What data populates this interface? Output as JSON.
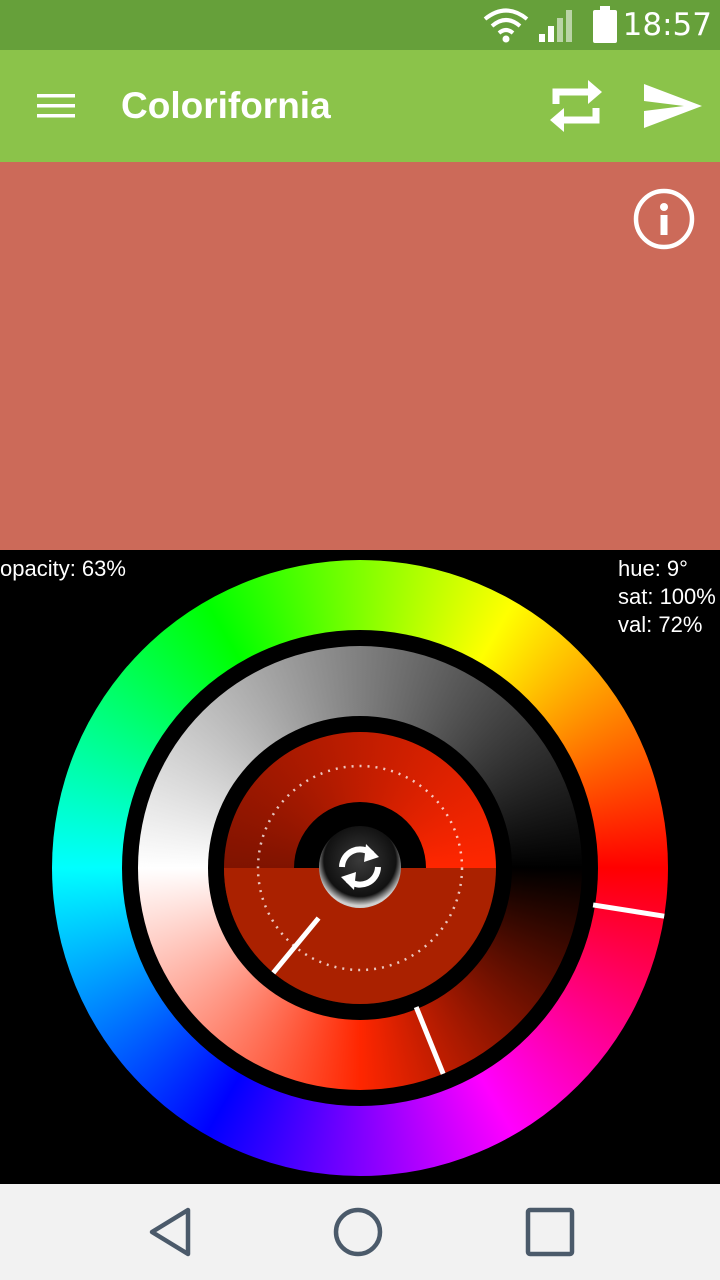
{
  "status_bar": {
    "time": "18:57",
    "icons": [
      "wifi-icon",
      "signal-icon",
      "battery-icon"
    ]
  },
  "toolbar": {
    "title": "Colorifornia",
    "icons": [
      "menu-icon",
      "swap-icon",
      "send-icon"
    ]
  },
  "preview": {
    "color": "#cc6a59",
    "icons": [
      "info-icon"
    ]
  },
  "picker": {
    "opacity_label": "opacity: 63%",
    "hue_label": "hue: 9°",
    "sat_label": "sat: 100%",
    "val_label": "val: 72%",
    "hue": 9,
    "saturation": 1.0,
    "value": 0.72,
    "opacity": 0.63,
    "icons": [
      "refresh-icon"
    ]
  },
  "nav_bar": {
    "icons": [
      "back-icon",
      "home-icon",
      "recents-icon"
    ]
  }
}
